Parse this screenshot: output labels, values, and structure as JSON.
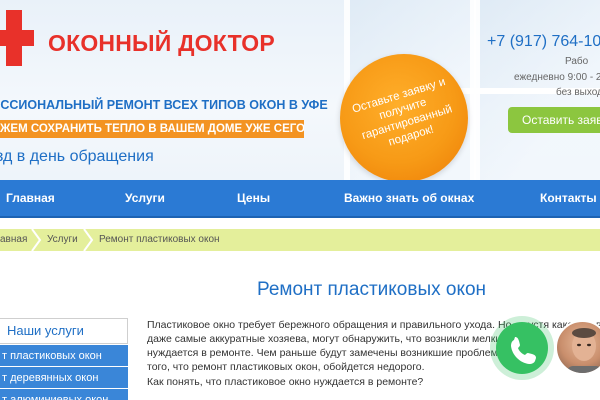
{
  "header": {
    "logo_text": "ОКОННЫЙ ДОКТОР",
    "tagline_primary": "ЕССИОНАЛЬНЫЙ РЕМОНТ ВСЕХ ТИПОВ ОКОН В УФЕ",
    "tagline_secondary": "ЖЕМ СОХРАНИТЬ ТЕПЛО В ВАШЕМ ДОМЕ УЖЕ СЕГОДНЯ!",
    "tagline_third": "зд в день обращения",
    "promo_text": "Оставьте заявку и получите гарантированный подарок!",
    "phone": "+7 (917) 764-10",
    "hours_line1": "Рабо",
    "hours_line2": "ежедневно 9:00 - 2",
    "hours_line3": "без выход",
    "order_button": "Оставить заявк"
  },
  "nav": {
    "items": [
      "Главная",
      "Услуги",
      "Цены",
      "Важно знать об окнах",
      "Контакты"
    ]
  },
  "breadcrumb": {
    "items": [
      "авная",
      "Услуги",
      "Ремонт пластиковых окон"
    ]
  },
  "main": {
    "title": "Ремонт пластиковых окон",
    "paragraph_lines": [
      "Пластиковое окно требует бережного обращения и правильного ухода. Но, спустя какое-то вр",
      "даже самые аккуратные хозяева, могут обнаружить, что возникли мелки",
      "нуждается в ремонте. Чем раньше будут замечены возникшие проблемы",
      "того, что ремонт пластиковых окон, обойдется недорого.",
      "Как понять, что пластиковое окно нуждается в ремонте?"
    ]
  },
  "sidebar": {
    "heading": "Наши услуги",
    "items": [
      "т пластиковых окон",
      "т деревянных окон",
      "т алюминиевых окон"
    ]
  },
  "widgets": {
    "call_icon": "phone-icon",
    "avatar_icon": "person-avatar"
  },
  "colors": {
    "brand_red": "#e8312a",
    "brand_blue": "#1f6fc5",
    "nav_blue": "#2b7ad4",
    "accent_orange": "#f39322",
    "accent_green": "#8cc63f",
    "breadcrumb_bg": "#e4ef9b",
    "call_green": "#36c163"
  }
}
